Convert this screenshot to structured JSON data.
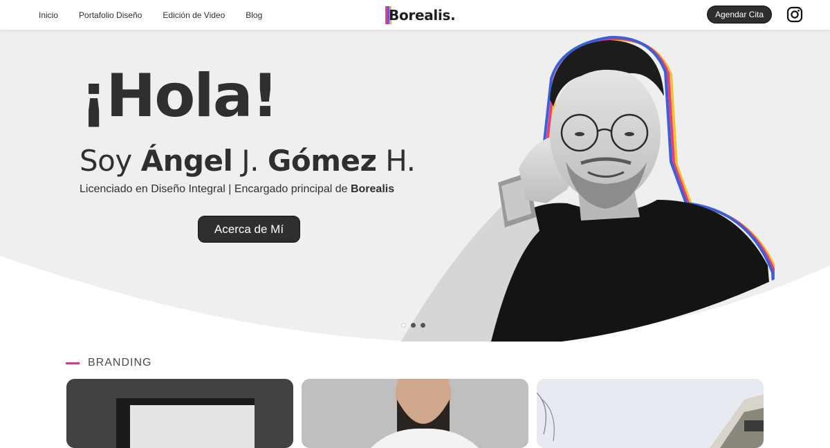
{
  "header": {
    "nav": [
      "Inicio",
      "Portafolio Diseño",
      "Edición de Video",
      "Blog"
    ],
    "logo_text": "Borealis.",
    "cta_label": "Agendar Cita",
    "instagram_icon": "instagram-icon"
  },
  "hero": {
    "title": "¡Hola!",
    "subtitle_prefix": "Soy ",
    "subtitle_bold_1": "Ángel",
    "subtitle_mid": " J. ",
    "subtitle_bold_2": "Gómez",
    "subtitle_suffix": " H.",
    "tagline_prefix": "Licenciado en Diseño Integral | Encargado principal de ",
    "tagline_bold": "Borealis",
    "button_label": "Acerca de Mí",
    "slides": {
      "total": 3,
      "active": 1
    }
  },
  "branding": {
    "label": "BRANDING"
  },
  "colors": {
    "accent": "#c8407e",
    "dark": "#2e2e2e",
    "hero_bg": "#efefef"
  }
}
